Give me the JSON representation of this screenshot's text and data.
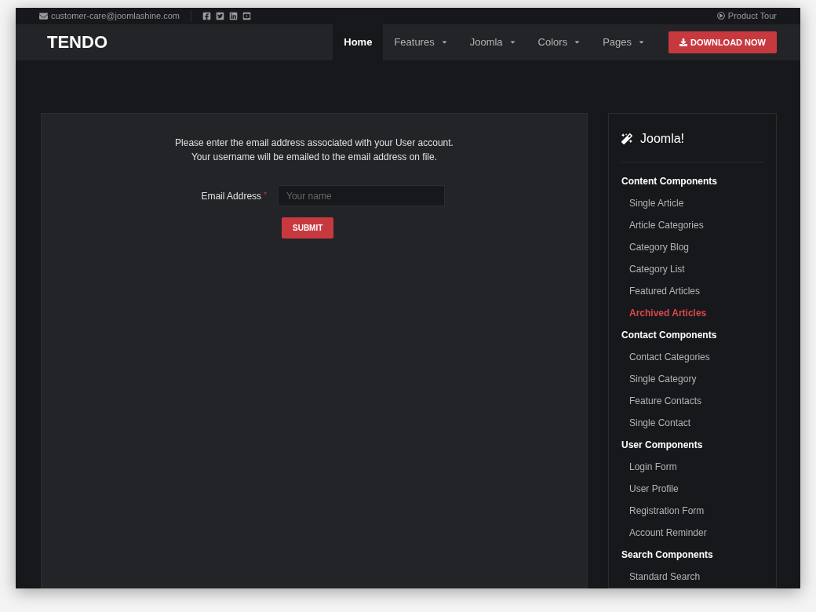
{
  "topbar": {
    "email": "customer-care@joomlashine.com",
    "tour": "Product Tour"
  },
  "nav": {
    "logo": "TENDO",
    "items": [
      {
        "label": "Home",
        "selected": true,
        "dropdown": false
      },
      {
        "label": "Features",
        "selected": false,
        "dropdown": true
      },
      {
        "label": "Joomla",
        "selected": false,
        "dropdown": true
      },
      {
        "label": "Colors",
        "selected": false,
        "dropdown": true
      },
      {
        "label": "Pages",
        "selected": false,
        "dropdown": true
      }
    ],
    "download": "DOWNLOAD NOW"
  },
  "form": {
    "intro": [
      "Please enter the email address associated with your User account.",
      "Your username will be emailed to the email address on file."
    ],
    "label": "Email Address",
    "required": "*",
    "placeholder": "Your name",
    "submit": "SUBMIT"
  },
  "sidebar": {
    "title": "Joomla!",
    "groups": [
      {
        "label": "Content Components",
        "children": [
          {
            "label": "Single Article",
            "selected": false
          },
          {
            "label": "Article Categories",
            "selected": false
          },
          {
            "label": "Category Blog",
            "selected": false
          },
          {
            "label": "Category List",
            "selected": false
          },
          {
            "label": "Featured Articles",
            "selected": false
          },
          {
            "label": "Archived Articles",
            "selected": true
          }
        ]
      },
      {
        "label": "Contact Components",
        "children": [
          {
            "label": "Contact Categories",
            "selected": false
          },
          {
            "label": "Single Category",
            "selected": false
          },
          {
            "label": "Feature Contacts",
            "selected": false
          },
          {
            "label": "Single Contact",
            "selected": false
          }
        ]
      },
      {
        "label": "User Components",
        "children": [
          {
            "label": "Login Form",
            "selected": false
          },
          {
            "label": "User Profile",
            "selected": false
          },
          {
            "label": "Registration Form",
            "selected": false
          },
          {
            "label": "Account Reminder",
            "selected": false
          }
        ]
      },
      {
        "label": "Search Components",
        "children": [
          {
            "label": "Standard Search",
            "selected": false
          }
        ]
      }
    ]
  }
}
